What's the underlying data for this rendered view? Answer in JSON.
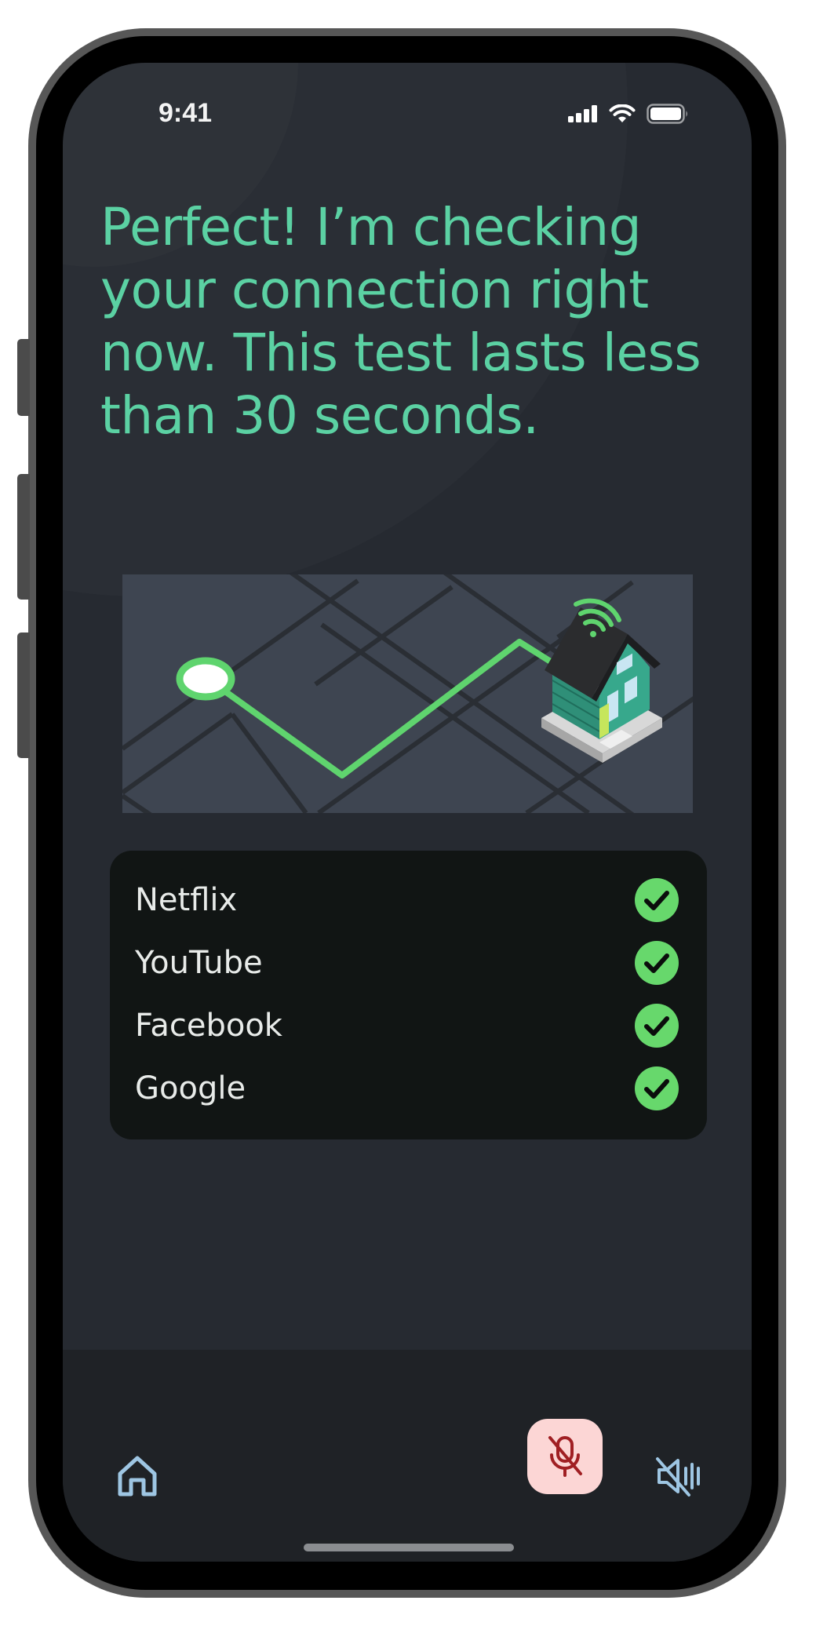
{
  "status_bar": {
    "time": "9:41",
    "icons": [
      "cellular-signal-icon",
      "wifi-icon",
      "battery-icon"
    ]
  },
  "headline": "Perfect! I’m checking your connection right now. This test lasts less than 30 seconds.",
  "illustration": {
    "icons": [
      "route-start-icon",
      "house-icon",
      "wifi-signal-icon"
    ]
  },
  "services": [
    {
      "name": "Netflix",
      "status": "check-icon"
    },
    {
      "name": "YouTube",
      "status": "check-icon"
    },
    {
      "name": "Facebook",
      "status": "check-icon"
    },
    {
      "name": "Google",
      "status": "check-icon"
    }
  ],
  "bottom_bar": {
    "home_icon": "home-icon",
    "mic_icon": "mic-off-icon",
    "speaker_icon": "speaker-muted-icon"
  },
  "colors": {
    "accent": "#5bd1a3",
    "route": "#5fd46e",
    "check": "#67d86c",
    "mic_button_bg": "#fcd6d5",
    "mic_icon": "#a01f23",
    "screen_bg": "#262a31",
    "card_bg": "#111514",
    "nav_icon": "#9ec6e3"
  }
}
